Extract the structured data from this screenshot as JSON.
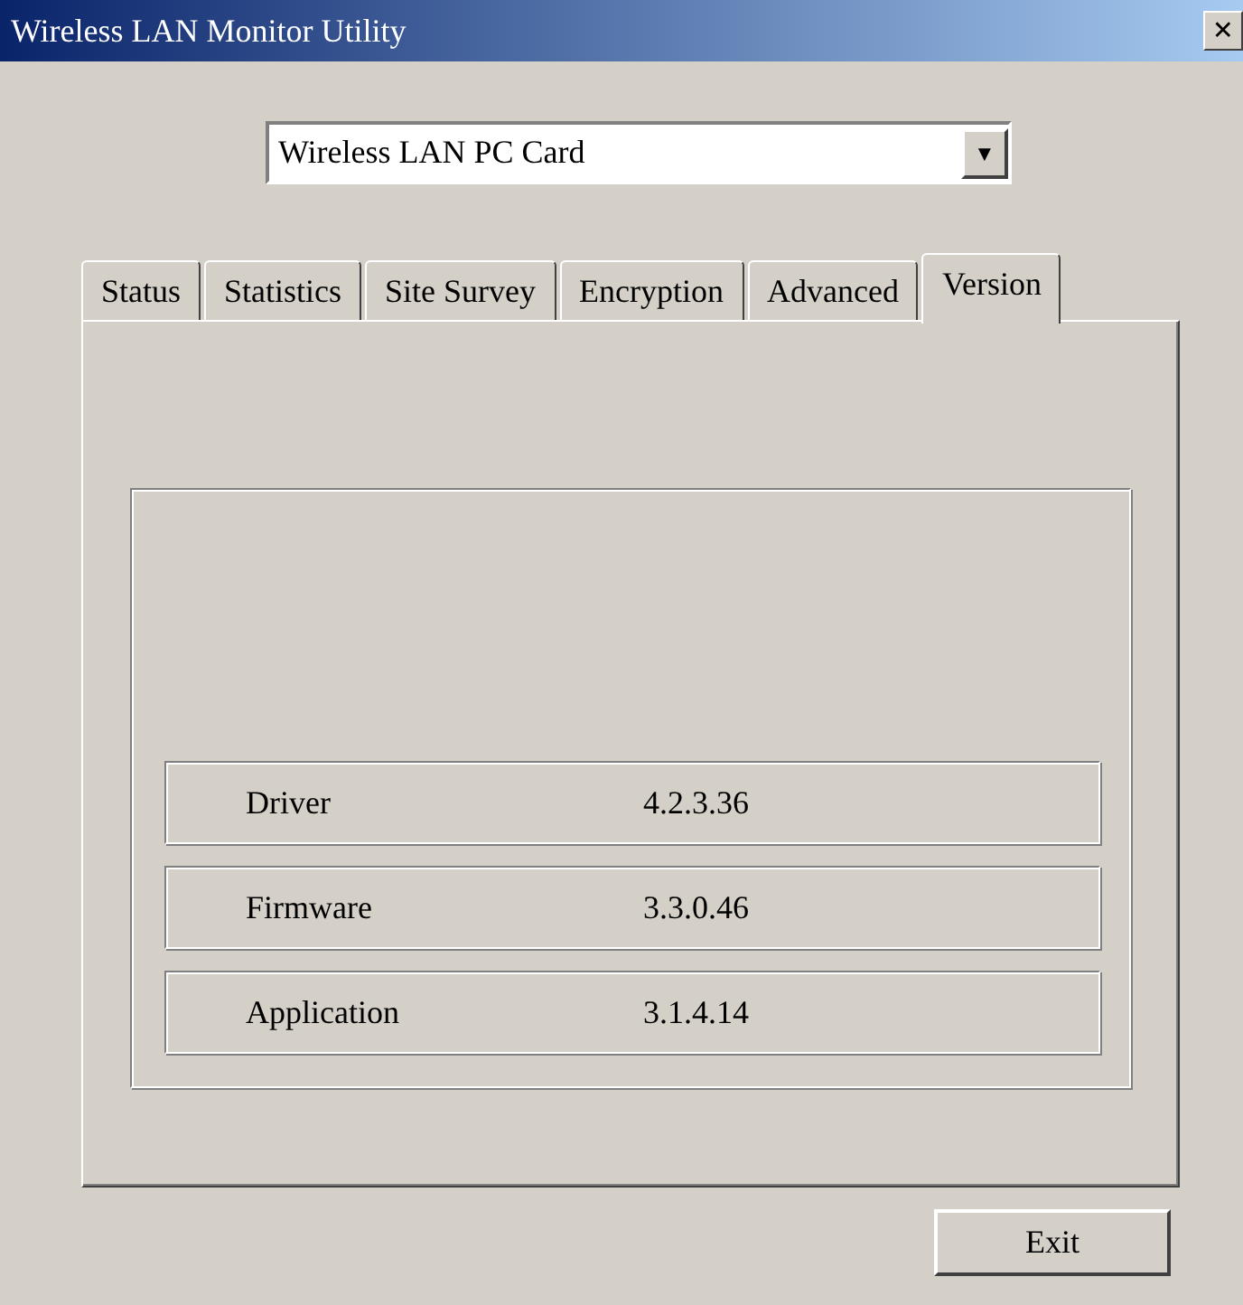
{
  "window": {
    "title": "Wireless LAN Monitor Utility",
    "close": "×"
  },
  "adapter": {
    "value": "Wireless LAN PC Card",
    "arrow": "▼"
  },
  "tabs": [
    {
      "label": "Status",
      "selected": false
    },
    {
      "label": "Statistics",
      "selected": false
    },
    {
      "label": "Site Survey",
      "selected": false
    },
    {
      "label": "Encryption",
      "selected": false
    },
    {
      "label": "Advanced",
      "selected": false
    },
    {
      "label": "Version",
      "selected": true
    }
  ],
  "versions": [
    {
      "name": "Driver",
      "value": "4.2.3.36"
    },
    {
      "name": "Firmware",
      "value": "3.3.0.46"
    },
    {
      "name": "Application",
      "value": "3.1.4.14"
    }
  ],
  "buttons": [
    "Exit"
  ]
}
